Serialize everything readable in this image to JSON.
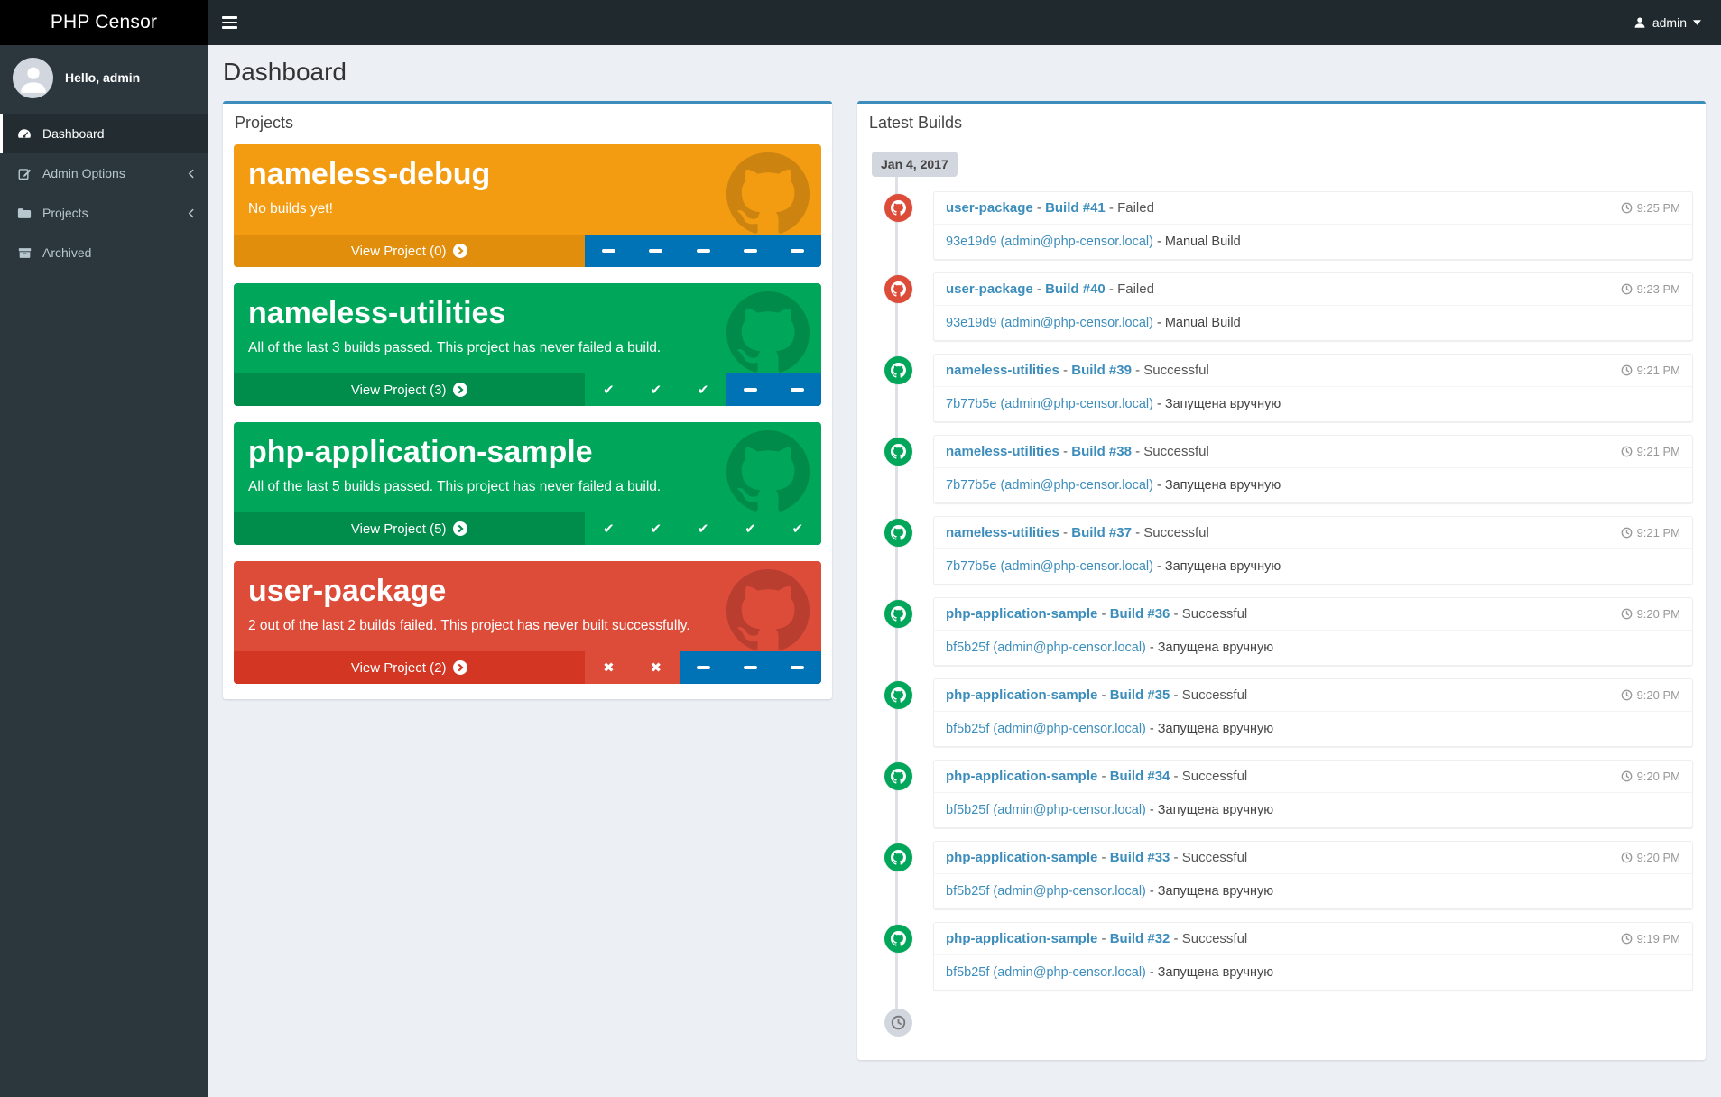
{
  "colors": {
    "accent_blue": "#3c8dbc",
    "pending_blue": "#0073b7",
    "success_green": "#00a65a",
    "failed_red": "#dd4b39",
    "warning_orange": "#f39c12"
  },
  "navbar": {
    "brand": "PHP Censor",
    "menu_icon": "hamburger-icon",
    "user_icon": "user-icon",
    "user_label": "admin",
    "caret_icon": "caret-down-icon"
  },
  "sidebar": {
    "greeting": "Hello, admin",
    "avatar_icon": "person-icon",
    "items": [
      {
        "label": "Dashboard",
        "icon": "gauge-icon",
        "active": true,
        "expandable": false
      },
      {
        "label": "Admin Options",
        "icon": "pencil-square-icon",
        "active": false,
        "expandable": true
      },
      {
        "label": "Projects",
        "icon": "folder-icon",
        "active": false,
        "expandable": true
      },
      {
        "label": "Archived",
        "icon": "archive-icon",
        "active": false,
        "expandable": false
      }
    ]
  },
  "page": {
    "title": "Dashboard"
  },
  "projects_panel": {
    "title": "Projects",
    "watermark_icon": "github-icon",
    "view_arrow_icon": "arrow-circle-right-icon",
    "cards": [
      {
        "name": "nameless-debug",
        "subtitle": "No builds yet!",
        "view_label": "View Project (0)",
        "bg": "#f39c12",
        "footer_bg": "#e08e0b",
        "statuses": [
          "pending",
          "pending",
          "pending",
          "pending",
          "pending"
        ]
      },
      {
        "name": "nameless-utilities",
        "subtitle": "All of the last 3 builds passed. This project has never failed a build.",
        "view_label": "View Project (3)",
        "bg": "#00a65a",
        "footer_bg": "#008d4c",
        "statuses": [
          "success",
          "success",
          "success",
          "pending",
          "pending"
        ]
      },
      {
        "name": "php-application-sample",
        "subtitle": "All of the last 5 builds passed. This project has never failed a build.",
        "view_label": "View Project (5)",
        "bg": "#00a65a",
        "footer_bg": "#008d4c",
        "statuses": [
          "success",
          "success",
          "success",
          "success",
          "success"
        ]
      },
      {
        "name": "user-package",
        "subtitle": "2 out of the last 2 builds failed. This project has never built successfully.",
        "view_label": "View Project (2)",
        "bg": "#dd4b39",
        "footer_bg": "#d33724",
        "statuses": [
          "failed",
          "failed",
          "pending",
          "pending",
          "pending"
        ]
      }
    ]
  },
  "builds_panel": {
    "title": "Latest Builds",
    "date_label": "Jan 4, 2017",
    "separator": " - ",
    "item_icon": "github-icon",
    "time_icon": "clock-icon",
    "end_icon": "clock-icon",
    "builds": [
      {
        "project": "user-package",
        "build": "Build #41",
        "status": "Failed",
        "commit": "93e19d9 (admin@php-censor.local)",
        "note": "Manual Build",
        "time": "9:25 PM",
        "result": "failed"
      },
      {
        "project": "user-package",
        "build": "Build #40",
        "status": "Failed",
        "commit": "93e19d9 (admin@php-censor.local)",
        "note": "Manual Build",
        "time": "9:23 PM",
        "result": "failed"
      },
      {
        "project": "nameless-utilities",
        "build": "Build #39",
        "status": "Successful",
        "commit": "7b77b5e (admin@php-censor.local)",
        "note": "Запущена вручную",
        "time": "9:21 PM",
        "result": "success"
      },
      {
        "project": "nameless-utilities",
        "build": "Build #38",
        "status": "Successful",
        "commit": "7b77b5e (admin@php-censor.local)",
        "note": "Запущена вручную",
        "time": "9:21 PM",
        "result": "success"
      },
      {
        "project": "nameless-utilities",
        "build": "Build #37",
        "status": "Successful",
        "commit": "7b77b5e (admin@php-censor.local)",
        "note": "Запущена вручную",
        "time": "9:21 PM",
        "result": "success"
      },
      {
        "project": "php-application-sample",
        "build": "Build #36",
        "status": "Successful",
        "commit": "bf5b25f (admin@php-censor.local)",
        "note": "Запущена вручную",
        "time": "9:20 PM",
        "result": "success"
      },
      {
        "project": "php-application-sample",
        "build": "Build #35",
        "status": "Successful",
        "commit": "bf5b25f (admin@php-censor.local)",
        "note": "Запущена вручную",
        "time": "9:20 PM",
        "result": "success"
      },
      {
        "project": "php-application-sample",
        "build": "Build #34",
        "status": "Successful",
        "commit": "bf5b25f (admin@php-censor.local)",
        "note": "Запущена вручную",
        "time": "9:20 PM",
        "result": "success"
      },
      {
        "project": "php-application-sample",
        "build": "Build #33",
        "status": "Successful",
        "commit": "bf5b25f (admin@php-censor.local)",
        "note": "Запущена вручную",
        "time": "9:20 PM",
        "result": "success"
      },
      {
        "project": "php-application-sample",
        "build": "Build #32",
        "status": "Successful",
        "commit": "bf5b25f (admin@php-censor.local)",
        "note": "Запущена вручную",
        "time": "9:19 PM",
        "result": "success"
      }
    ]
  }
}
